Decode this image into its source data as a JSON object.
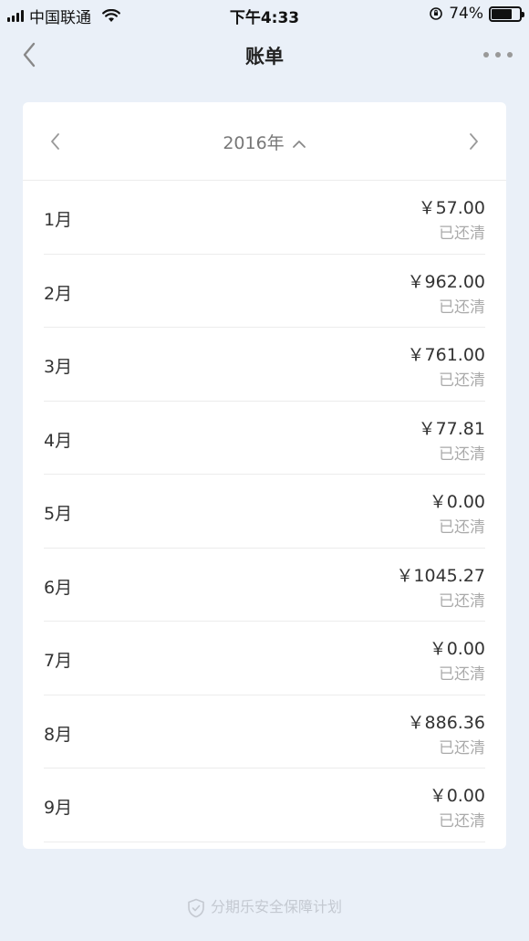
{
  "status_bar": {
    "carrier": "中国联通",
    "time": "下午4:33",
    "battery": "74%",
    "battery_level": 0.74
  },
  "nav": {
    "title": "账单"
  },
  "year_header": {
    "year": "2016年"
  },
  "months": [
    {
      "month": "1月",
      "amount": "￥57.00",
      "status": "已还清"
    },
    {
      "month": "2月",
      "amount": "￥962.00",
      "status": "已还清"
    },
    {
      "month": "3月",
      "amount": "￥761.00",
      "status": "已还清"
    },
    {
      "month": "4月",
      "amount": "￥77.81",
      "status": "已还清"
    },
    {
      "month": "5月",
      "amount": "￥0.00",
      "status": "已还清"
    },
    {
      "month": "6月",
      "amount": "￥1045.27",
      "status": "已还清"
    },
    {
      "month": "7月",
      "amount": "￥0.00",
      "status": "已还清"
    },
    {
      "month": "8月",
      "amount": "￥886.36",
      "status": "已还清"
    },
    {
      "month": "9月",
      "amount": "￥0.00",
      "status": "已还清"
    }
  ],
  "footer": {
    "text": "分期乐安全保障计划"
  },
  "icons": [
    "signal-icon",
    "wifi-icon",
    "orientation-lock-icon",
    "battery-icon",
    "back-arrow-icon",
    "more-icon",
    "chevron-left-icon",
    "chevron-up-icon",
    "chevron-right-icon",
    "shield-check-icon"
  ]
}
